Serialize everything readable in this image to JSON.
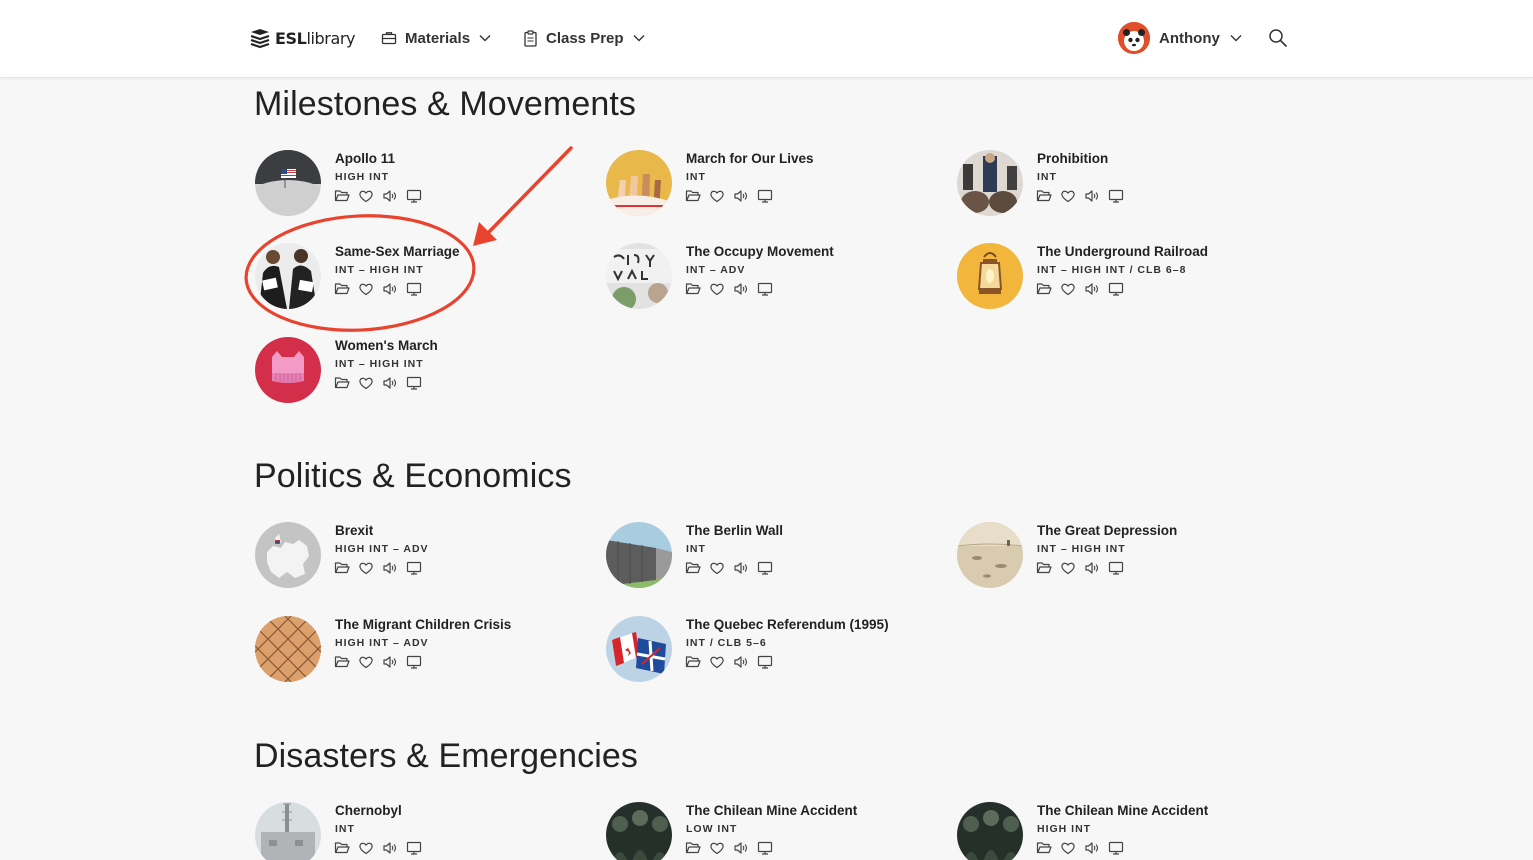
{
  "header": {
    "logo_strong": "ESL",
    "logo_rest": "library",
    "nav": [
      {
        "label": "Materials",
        "icon": "briefcase-icon"
      },
      {
        "label": "Class Prep",
        "icon": "clipboard-icon"
      }
    ],
    "user": {
      "name": "Anthony"
    },
    "search_icon": "search-icon"
  },
  "sections": [
    {
      "title": "Milestones & Movements",
      "cards": [
        {
          "title": "Apollo 11",
          "level": "HIGH INT",
          "thumb_color": "#c9c9c9"
        },
        {
          "title": "March for Our Lives",
          "level": "INT",
          "thumb_color": "#e9b84a"
        },
        {
          "title": "Prohibition",
          "level": "INT",
          "thumb_color": "#8b8079"
        },
        {
          "title": "Same-Sex Marriage",
          "level": "INT – HIGH INT",
          "thumb_color": "#e7e7e7"
        },
        {
          "title": "The Occupy Movement",
          "level": "INT – ADV",
          "thumb_color": "#dadada"
        },
        {
          "title": "The Underground Railroad",
          "level": "INT – HIGH INT / CLB 6–8",
          "thumb_color": "#f2b63c"
        },
        {
          "title": "Women's March",
          "level": "INT – HIGH INT",
          "thumb_color": "#d32e4a"
        }
      ]
    },
    {
      "title": "Politics & Economics",
      "cards": [
        {
          "title": "Brexit",
          "level": "HIGH INT – ADV",
          "thumb_color": "#cfcfcf"
        },
        {
          "title": "The Berlin Wall",
          "level": "INT",
          "thumb_color": "#6d6d6d"
        },
        {
          "title": "The Great Depression",
          "level": "INT – HIGH INT",
          "thumb_color": "#d3c4a6"
        },
        {
          "title": "The Migrant Children Crisis",
          "level": "HIGH INT – ADV",
          "thumb_color": "#d9a26e"
        },
        {
          "title": "The Quebec Referendum (1995)",
          "level": "INT / CLB 5–6",
          "thumb_color": "#b9cfe3"
        }
      ]
    },
    {
      "title": "Disasters & Emergencies",
      "cards": [
        {
          "title": "Chernobyl",
          "level": "INT",
          "thumb_color": "#bfc2c4"
        },
        {
          "title": "The Chilean Mine Accident",
          "level": "LOW INT",
          "thumb_color": "#2e3a2f"
        },
        {
          "title": "The Chilean Mine Accident",
          "level": "HIGH INT",
          "thumb_color": "#2e3a2f"
        }
      ]
    }
  ],
  "card_actions": [
    "folder-icon",
    "heart-icon",
    "audio-icon",
    "presentation-icon"
  ],
  "annotation_color": "#e8432f"
}
